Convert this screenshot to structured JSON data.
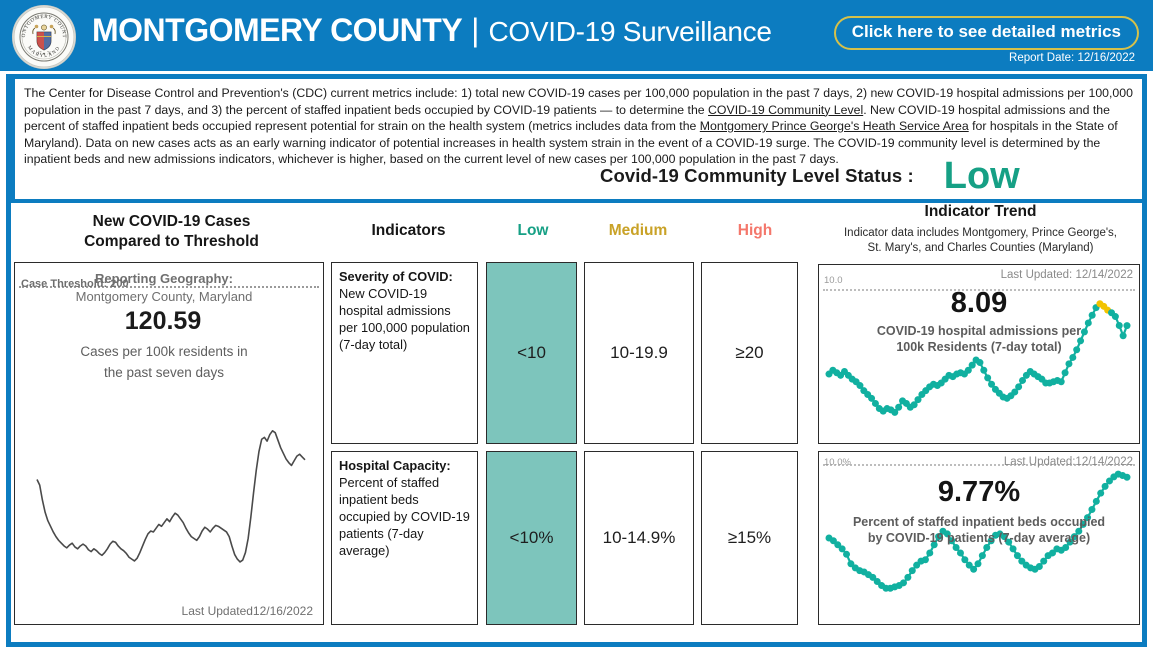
{
  "header": {
    "seal_alt": "montgomery-county-seal",
    "title_bold": "MONTGOMERY COUNTY",
    "divider": "|",
    "title_light": "COVID-19 Surveillance",
    "cta_label": "Click here to see detailed metrics",
    "report_date": "Report Date: 12/16/2022",
    "bg_color": "#0C7CC0",
    "cta_border_color": "#D6C14A"
  },
  "intro": {
    "paragraph_parts": [
      {
        "t": "The Center for Disease Control and Prevention's (CDC) current metrics include: 1) total new COVID-19 cases per 100,000 population in the past 7 days, 2) new COVID-19 hospital admissions per 100,000 population in the past 7 days, and 3) the percent of staffed inpatient beds occupied by COVID-19 patients — to determine the ",
        "u": false
      },
      {
        "t": "COVID-19 Community Level",
        "u": true
      },
      {
        "t": ". New COVID-19 hospital admissions and the percent of staffed inpatient beds occupied represent potential for strain on the health system (metrics includes data from the ",
        "u": false
      },
      {
        "t": "Montgomery Prince George's Heath Service Area",
        "u": true
      },
      {
        "t": " for hospitals in the State of Maryland). Data on new cases acts as an early warning indicator of potential increases in health system strain in the event of a COVID-19 surge. The COVID-19 community level is determined by the inpatient beds and new admissions indicators, whichever is higher, based on the current level of new cases per 100,000 population in the past 7 days.",
        "u": false
      }
    ]
  },
  "status": {
    "label": "Covid-19 Community Level Status :",
    "value": "Low",
    "value_color": "#16A085"
  },
  "cases_panel": {
    "title_line1": "New COVID-19 Cases",
    "title_line2": "Compared to Threshold",
    "reporting_geography_label": "Reporting Geography:",
    "reporting_geography_value": "Montgomery County, Maryland",
    "metric_value": "120.59",
    "metric_caption_line1": "Cases per 100k residents in",
    "metric_caption_line2": "the past seven days",
    "threshold_label": "Case Threshold: 200",
    "last_updated": "Last Updated12/16/2022"
  },
  "indicators": {
    "header_indicators": "Indicators",
    "header_low": "Low",
    "header_medium": "Medium",
    "header_high": "High",
    "low_color": "#16A085",
    "medium_color": "#C9A227",
    "high_color": "#F4776B",
    "highlight_fill": "#7DC5BC",
    "rows": [
      {
        "title": "Severity of COVID:",
        "description": "New COVID-19 hospital admissions per 100,000 population (7-day total)",
        "low": "<10",
        "medium": "10-19.9",
        "high": "≥20",
        "active": "low"
      },
      {
        "title": "Hospital Capacity:",
        "description": "Percent of staffed inpatient beds occupied by COVID-19 patients (7-day average)",
        "low": "<10%",
        "medium": "10-14.9%",
        "high": "≥15%",
        "active": "low"
      }
    ]
  },
  "trend": {
    "title": "Indicator Trend",
    "subtitle_line1": "Indicator data includes Montgomery, Prince George's,",
    "subtitle_line2": "St. Mary's, and Charles Counties (Maryland)",
    "charts": [
      {
        "last_updated": "Last Updated:  12/14/2022",
        "threshold_label": "10.0",
        "value": "8.09",
        "caption_line1": "COVID-19 hospital admissions per",
        "caption_line2": "100k Residents (7-day total)",
        "series_color": "#11B0A0",
        "highlight_color": "#F2C300"
      },
      {
        "last_updated": "Last Updated:12/14/2022",
        "threshold_label": "10.0%",
        "value": "9.77%",
        "caption_line1": "Percent of staffed inpatient beds occupied",
        "caption_line2": "by COVID-19 patients (7-day average)",
        "series_color": "#11B0A0",
        "highlight_color": "#F2C300"
      }
    ]
  },
  "chart_data": [
    {
      "type": "line",
      "name": "new-cases-per-100k-sparkline",
      "title": "New COVID-19 Cases Compared to Threshold",
      "ylabel": "Cases per 100k residents (7-day)",
      "threshold": 200,
      "threshold_label": "Case Threshold: 200",
      "current_value": 120.59,
      "grid": false,
      "legend": "none",
      "ylim": [
        0,
        220
      ],
      "values": [
        118,
        112,
        96,
        83,
        74,
        68,
        62,
        57,
        53,
        50,
        47,
        45,
        48,
        50,
        46,
        44,
        47,
        49,
        47,
        43,
        41,
        44,
        42,
        39,
        37,
        40,
        44,
        49,
        52,
        51,
        47,
        44,
        42,
        39,
        35,
        33,
        31,
        34,
        40,
        47,
        54,
        60,
        63,
        62,
        66,
        70,
        68,
        72,
        76,
        73,
        78,
        82,
        80,
        76,
        72,
        66,
        61,
        57,
        55,
        53,
        57,
        63,
        67,
        65,
        62,
        66,
        69,
        68,
        66,
        64,
        62,
        57,
        47,
        38,
        33,
        30,
        32,
        40,
        55,
        78,
        104,
        128,
        148,
        161,
        163,
        159,
        166,
        170,
        168,
        160,
        152,
        146,
        140,
        136,
        133,
        138,
        143,
        145,
        142,
        139
      ]
    },
    {
      "type": "scatter-line",
      "name": "hospital-admissions-trend",
      "title": "COVID-19 hospital admissions per 100k Residents (7-day total)",
      "threshold": 10.0,
      "threshold_label": "10.0",
      "current_value": 8.09,
      "last_updated": "12/14/2022",
      "grid": false,
      "legend": "none",
      "ylim": [
        0,
        10.8
      ],
      "values": [
        4.3,
        4.6,
        4.4,
        4.2,
        4.5,
        4.2,
        3.9,
        3.7,
        3.4,
        3.0,
        2.7,
        2.4,
        2.0,
        1.6,
        1.4,
        1.6,
        1.5,
        1.3,
        1.7,
        2.2,
        2.0,
        1.7,
        1.9,
        2.3,
        2.7,
        3.0,
        3.3,
        3.5,
        3.4,
        3.6,
        3.9,
        4.2,
        4.1,
        4.3,
        4.4,
        4.3,
        4.6,
        5.0,
        5.4,
        5.2,
        4.6,
        4.0,
        3.5,
        3.1,
        2.8,
        2.5,
        2.4,
        2.6,
        2.9,
        3.3,
        3.8,
        4.2,
        4.5,
        4.3,
        4.1,
        3.9,
        3.6,
        3.6,
        3.7,
        3.8,
        3.7,
        4.4,
        5.1,
        5.6,
        6.2,
        6.9,
        7.6,
        8.3,
        8.9,
        9.5,
        9.8,
        9.6,
        9.3,
        9.1,
        8.8,
        8.1,
        7.3,
        8.09
      ],
      "highlight_indices": [
        70,
        71,
        72
      ]
    },
    {
      "type": "scatter-line",
      "name": "inpatient-beds-occupied-trend",
      "title": "Percent of staffed inpatient beds occupied by COVID-19 patients (7-day average)",
      "threshold": 10.0,
      "threshold_label": "10.0%",
      "current_value": 9.77,
      "last_updated": "12/14/2022",
      "grid": false,
      "legend": "none",
      "ylim": [
        0,
        10.6
      ],
      "values": [
        5.3,
        5.1,
        4.8,
        4.5,
        4.1,
        3.4,
        3.1,
        2.9,
        2.8,
        2.6,
        2.4,
        2.1,
        1.8,
        1.6,
        1.6,
        1.7,
        1.8,
        2.0,
        2.4,
        2.9,
        3.3,
        3.6,
        3.7,
        4.2,
        4.8,
        5.4,
        5.8,
        5.6,
        5.1,
        4.6,
        4.2,
        3.7,
        3.3,
        3.0,
        3.4,
        4.0,
        4.6,
        5.1,
        5.5,
        5.6,
        5.4,
        5.0,
        4.5,
        4.0,
        3.6,
        3.3,
        3.1,
        3.0,
        3.2,
        3.6,
        4.0,
        4.2,
        4.5,
        4.4,
        4.6,
        5.0,
        5.4,
        5.8,
        6.3,
        6.8,
        7.4,
        8.0,
        8.6,
        9.1,
        9.5,
        9.8,
        10.0,
        9.9,
        9.77
      ]
    }
  ]
}
